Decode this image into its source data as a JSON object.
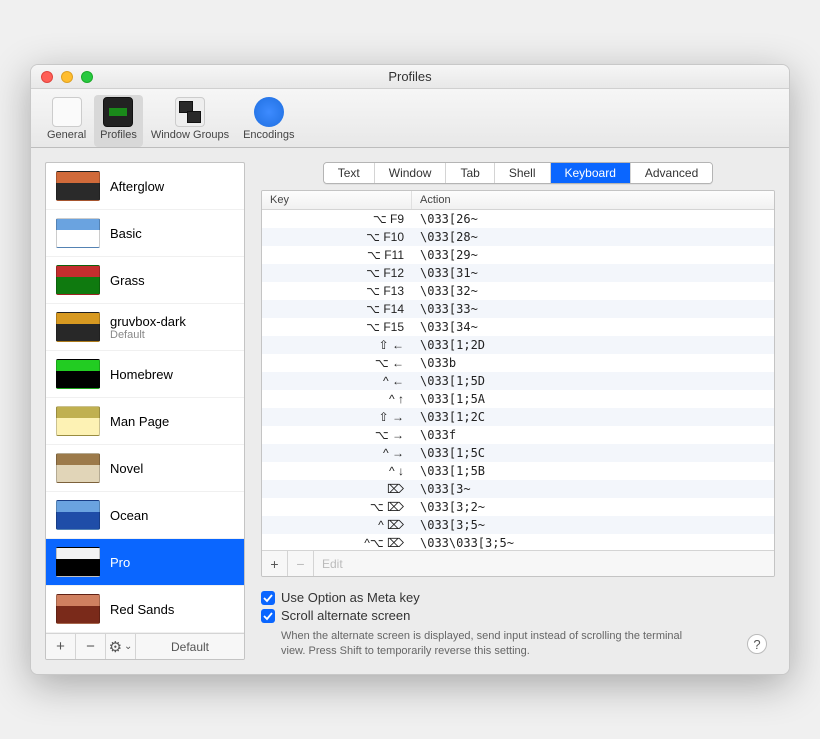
{
  "window": {
    "title": "Profiles"
  },
  "toolbar": {
    "items": [
      {
        "label": "General"
      },
      {
        "label": "Profiles"
      },
      {
        "label": "Window Groups"
      },
      {
        "label": "Encodings"
      }
    ]
  },
  "profiles": [
    {
      "name": "Afterglow",
      "thumb_bg": "#2a2a2a",
      "thumb_accent": "#d06a3a"
    },
    {
      "name": "Basic",
      "thumb_bg": "#ffffff",
      "thumb_accent": "#6aa3e0"
    },
    {
      "name": "Grass",
      "thumb_bg": "#0f7a0f",
      "thumb_accent": "#c42e2e"
    },
    {
      "name": "gruvbox-dark",
      "subtitle": "Default",
      "thumb_bg": "#282828",
      "thumb_accent": "#d79921"
    },
    {
      "name": "Homebrew",
      "thumb_bg": "#000000",
      "thumb_accent": "#22cc22"
    },
    {
      "name": "Man Page",
      "thumb_bg": "#fdf2b4",
      "thumb_accent": "#c0b050"
    },
    {
      "name": "Novel",
      "thumb_bg": "#e1d5b8",
      "thumb_accent": "#9c7a4a"
    },
    {
      "name": "Ocean",
      "thumb_bg": "#1f4da8",
      "thumb_accent": "#6aa3e0"
    },
    {
      "name": "Pro",
      "selected": true,
      "thumb_bg": "#000000",
      "thumb_accent": "#f2f2f2"
    },
    {
      "name": "Red Sands",
      "thumb_bg": "#7a2a1a",
      "thumb_accent": "#d08060"
    }
  ],
  "sidebar_footer": {
    "add": "+",
    "remove": "−",
    "menu": "⚙︎",
    "chevron": "⌄",
    "default_label": "Default"
  },
  "tabs": [
    "Text",
    "Window",
    "Tab",
    "Shell",
    "Keyboard",
    "Advanced"
  ],
  "active_tab_index": 4,
  "table": {
    "headers": {
      "key": "Key",
      "action": "Action"
    },
    "rows": [
      {
        "key": "⌥ F9",
        "action": "\\033[26~"
      },
      {
        "key": "⌥ F10",
        "action": "\\033[28~"
      },
      {
        "key": "⌥ F11",
        "action": "\\033[29~"
      },
      {
        "key": "⌥ F12",
        "action": "\\033[31~"
      },
      {
        "key": "⌥ F13",
        "action": "\\033[32~"
      },
      {
        "key": "⌥ F14",
        "action": "\\033[33~"
      },
      {
        "key": "⌥ F15",
        "action": "\\033[34~"
      },
      {
        "key": "⇧ ←",
        "action": "\\033[1;2D"
      },
      {
        "key": "⌥ ←",
        "action": "\\033b"
      },
      {
        "key": "^ ←",
        "action": "\\033[1;5D"
      },
      {
        "key": "^ ↑",
        "action": "\\033[1;5A"
      },
      {
        "key": "⇧ →",
        "action": "\\033[1;2C"
      },
      {
        "key": "⌥ →",
        "action": "\\033f"
      },
      {
        "key": "^ →",
        "action": "\\033[1;5C"
      },
      {
        "key": "^ ↓",
        "action": "\\033[1;5B"
      },
      {
        "key": "⌦",
        "action": "\\033[3~"
      },
      {
        "key": "⌥ ⌦",
        "action": "\\033[3;2~"
      },
      {
        "key": "^ ⌦",
        "action": "\\033[3;5~"
      },
      {
        "key": "^⌥ ⌦",
        "action": "\\033\\033[3;5~"
      }
    ],
    "footer": {
      "add": "+",
      "remove": "−",
      "edit": "Edit"
    }
  },
  "options": {
    "meta": "Use Option as Meta key",
    "scroll": "Scroll alternate screen",
    "hint": "When the alternate screen is displayed, send input instead of scrolling the terminal view. Press Shift to temporarily reverse this setting."
  },
  "help": "?"
}
